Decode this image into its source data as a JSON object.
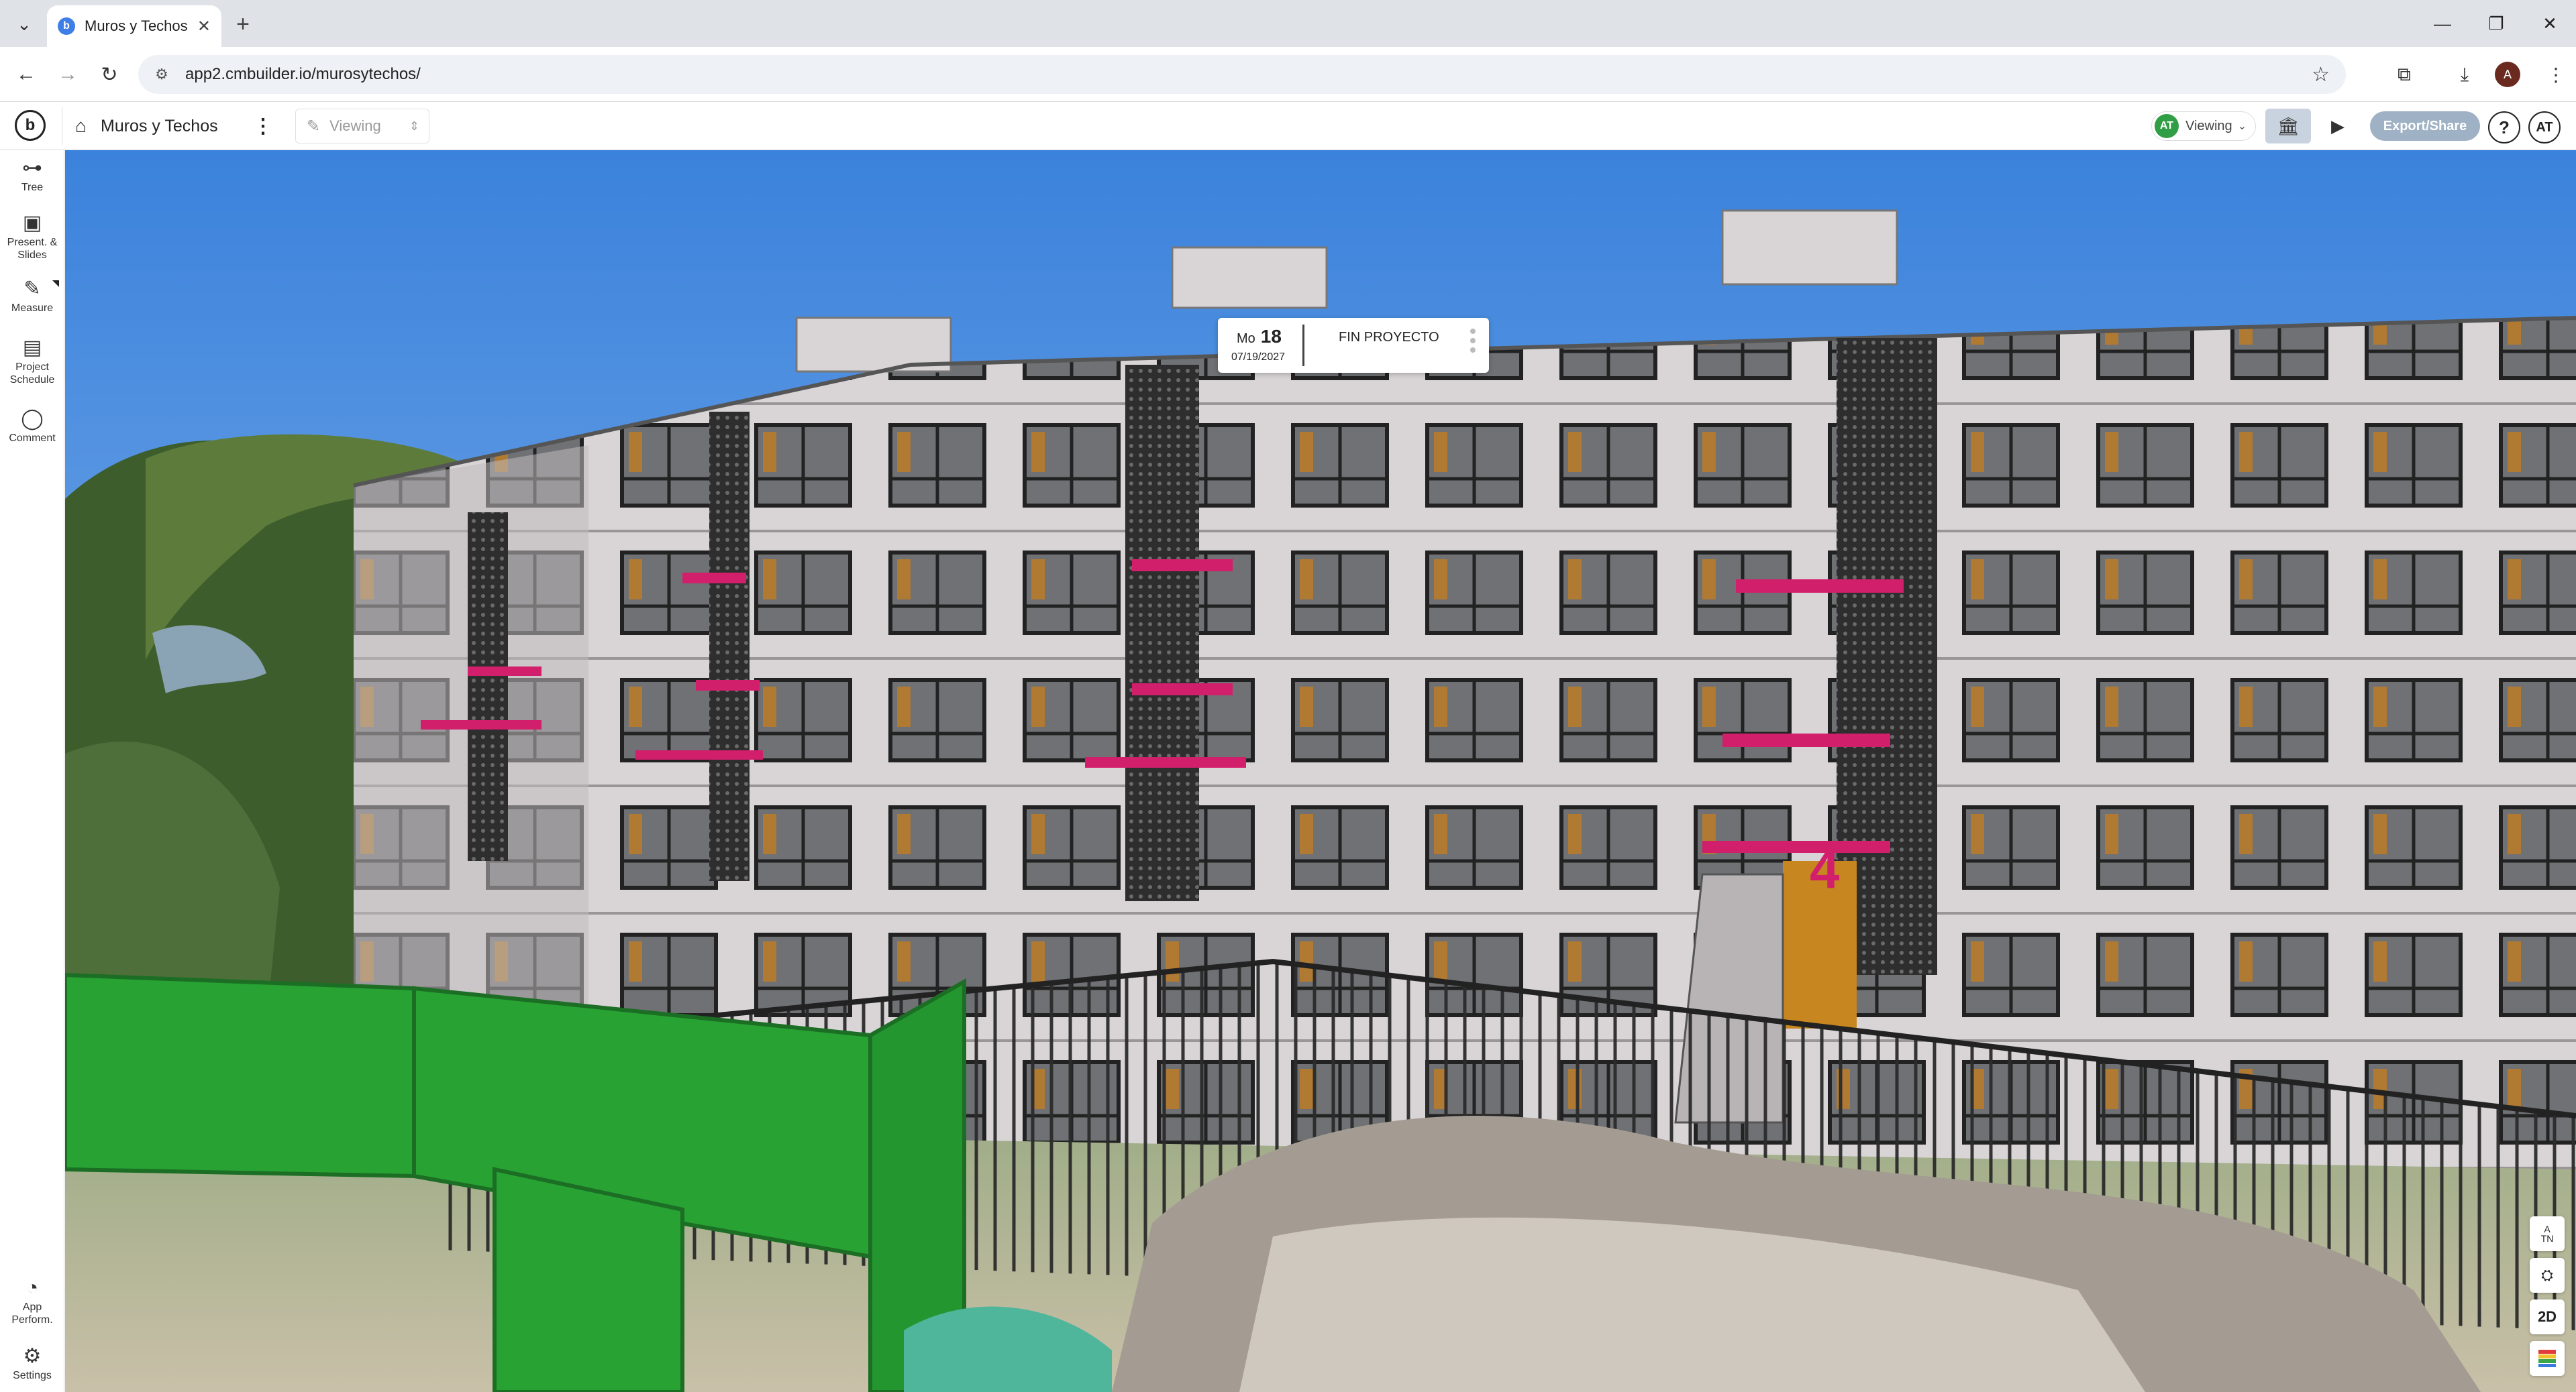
{
  "browser": {
    "tab_title": "Muros y Techos",
    "tab_favicon": "cmbuilder-logo-icon",
    "new_tab_label": "+",
    "url": "app2.cmbuilder.io/murosytechos/",
    "profile_initial": "A"
  },
  "app": {
    "logo_letter": "b",
    "project_name": "Muros y Techos",
    "mode_label": "Viewing",
    "viewer_initials": "AT",
    "viewer_mode": "Viewing",
    "export_label": "Export/Share",
    "help_label": "?",
    "user_initials": "AT",
    "accent_color": "#9fb1c4"
  },
  "rail": {
    "tree": "Tree",
    "present_line1": "Present. &",
    "present_line2": "Slides",
    "measure": "Measure",
    "schedule_line1": "Project",
    "schedule_line2": "Schedule",
    "comment": "Comment",
    "perf_line1": "App",
    "perf_line2": "Perform.",
    "settings": "Settings"
  },
  "schedule": {
    "weekday": "Mo",
    "day": "18",
    "date": "07/19/2027",
    "title": "FIN PROYECTO"
  },
  "view_controls": {
    "compass_top": "A",
    "compass_bottom": "TN",
    "two_d": "2D"
  }
}
